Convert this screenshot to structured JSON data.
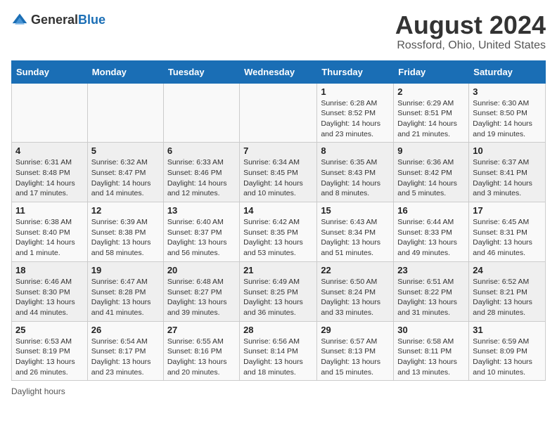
{
  "header": {
    "logo_general": "General",
    "logo_blue": "Blue",
    "main_title": "August 2024",
    "subtitle": "Rossford, Ohio, United States"
  },
  "footer": {
    "daylight_note": "Daylight hours"
  },
  "days_of_week": [
    "Sunday",
    "Monday",
    "Tuesday",
    "Wednesday",
    "Thursday",
    "Friday",
    "Saturday"
  ],
  "weeks": [
    [
      {
        "day": "",
        "info": ""
      },
      {
        "day": "",
        "info": ""
      },
      {
        "day": "",
        "info": ""
      },
      {
        "day": "",
        "info": ""
      },
      {
        "day": "1",
        "info": "Sunrise: 6:28 AM\nSunset: 8:52 PM\nDaylight: 14 hours and 23 minutes."
      },
      {
        "day": "2",
        "info": "Sunrise: 6:29 AM\nSunset: 8:51 PM\nDaylight: 14 hours and 21 minutes."
      },
      {
        "day": "3",
        "info": "Sunrise: 6:30 AM\nSunset: 8:50 PM\nDaylight: 14 hours and 19 minutes."
      }
    ],
    [
      {
        "day": "4",
        "info": "Sunrise: 6:31 AM\nSunset: 8:48 PM\nDaylight: 14 hours and 17 minutes."
      },
      {
        "day": "5",
        "info": "Sunrise: 6:32 AM\nSunset: 8:47 PM\nDaylight: 14 hours and 14 minutes."
      },
      {
        "day": "6",
        "info": "Sunrise: 6:33 AM\nSunset: 8:46 PM\nDaylight: 14 hours and 12 minutes."
      },
      {
        "day": "7",
        "info": "Sunrise: 6:34 AM\nSunset: 8:45 PM\nDaylight: 14 hours and 10 minutes."
      },
      {
        "day": "8",
        "info": "Sunrise: 6:35 AM\nSunset: 8:43 PM\nDaylight: 14 hours and 8 minutes."
      },
      {
        "day": "9",
        "info": "Sunrise: 6:36 AM\nSunset: 8:42 PM\nDaylight: 14 hours and 5 minutes."
      },
      {
        "day": "10",
        "info": "Sunrise: 6:37 AM\nSunset: 8:41 PM\nDaylight: 14 hours and 3 minutes."
      }
    ],
    [
      {
        "day": "11",
        "info": "Sunrise: 6:38 AM\nSunset: 8:40 PM\nDaylight: 14 hours and 1 minute."
      },
      {
        "day": "12",
        "info": "Sunrise: 6:39 AM\nSunset: 8:38 PM\nDaylight: 13 hours and 58 minutes."
      },
      {
        "day": "13",
        "info": "Sunrise: 6:40 AM\nSunset: 8:37 PM\nDaylight: 13 hours and 56 minutes."
      },
      {
        "day": "14",
        "info": "Sunrise: 6:42 AM\nSunset: 8:35 PM\nDaylight: 13 hours and 53 minutes."
      },
      {
        "day": "15",
        "info": "Sunrise: 6:43 AM\nSunset: 8:34 PM\nDaylight: 13 hours and 51 minutes."
      },
      {
        "day": "16",
        "info": "Sunrise: 6:44 AM\nSunset: 8:33 PM\nDaylight: 13 hours and 49 minutes."
      },
      {
        "day": "17",
        "info": "Sunrise: 6:45 AM\nSunset: 8:31 PM\nDaylight: 13 hours and 46 minutes."
      }
    ],
    [
      {
        "day": "18",
        "info": "Sunrise: 6:46 AM\nSunset: 8:30 PM\nDaylight: 13 hours and 44 minutes."
      },
      {
        "day": "19",
        "info": "Sunrise: 6:47 AM\nSunset: 8:28 PM\nDaylight: 13 hours and 41 minutes."
      },
      {
        "day": "20",
        "info": "Sunrise: 6:48 AM\nSunset: 8:27 PM\nDaylight: 13 hours and 39 minutes."
      },
      {
        "day": "21",
        "info": "Sunrise: 6:49 AM\nSunset: 8:25 PM\nDaylight: 13 hours and 36 minutes."
      },
      {
        "day": "22",
        "info": "Sunrise: 6:50 AM\nSunset: 8:24 PM\nDaylight: 13 hours and 33 minutes."
      },
      {
        "day": "23",
        "info": "Sunrise: 6:51 AM\nSunset: 8:22 PM\nDaylight: 13 hours and 31 minutes."
      },
      {
        "day": "24",
        "info": "Sunrise: 6:52 AM\nSunset: 8:21 PM\nDaylight: 13 hours and 28 minutes."
      }
    ],
    [
      {
        "day": "25",
        "info": "Sunrise: 6:53 AM\nSunset: 8:19 PM\nDaylight: 13 hours and 26 minutes."
      },
      {
        "day": "26",
        "info": "Sunrise: 6:54 AM\nSunset: 8:17 PM\nDaylight: 13 hours and 23 minutes."
      },
      {
        "day": "27",
        "info": "Sunrise: 6:55 AM\nSunset: 8:16 PM\nDaylight: 13 hours and 20 minutes."
      },
      {
        "day": "28",
        "info": "Sunrise: 6:56 AM\nSunset: 8:14 PM\nDaylight: 13 hours and 18 minutes."
      },
      {
        "day": "29",
        "info": "Sunrise: 6:57 AM\nSunset: 8:13 PM\nDaylight: 13 hours and 15 minutes."
      },
      {
        "day": "30",
        "info": "Sunrise: 6:58 AM\nSunset: 8:11 PM\nDaylight: 13 hours and 13 minutes."
      },
      {
        "day": "31",
        "info": "Sunrise: 6:59 AM\nSunset: 8:09 PM\nDaylight: 13 hours and 10 minutes."
      }
    ]
  ]
}
